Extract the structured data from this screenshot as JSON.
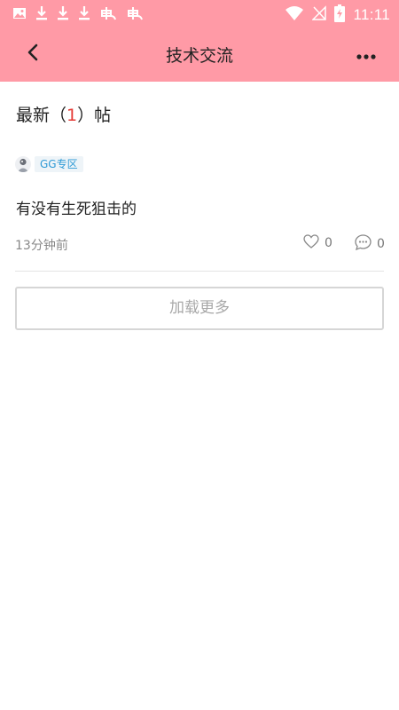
{
  "status_bar": {
    "time": "11:11",
    "icons": [
      "image-icon",
      "download-icon",
      "download-icon",
      "download-icon",
      "bug-app-icon",
      "bug-app-icon",
      "wifi-icon",
      "no-signal-icon",
      "battery-charging-icon"
    ]
  },
  "header": {
    "title": "技术交流",
    "back_icon": "chevron-left-icon",
    "more_icon": "more-dots-icon"
  },
  "section": {
    "prefix": "最新（",
    "count": "1",
    "suffix": "）帖"
  },
  "posts": [
    {
      "tag": "GG专区",
      "title": "有没有生死狙击的",
      "time": "13分钟前",
      "likes": "0",
      "comments": "0"
    }
  ],
  "load_more_label": "加载更多",
  "colors": {
    "header_bg": "#ff9aa6",
    "tag_text": "#2f9ad6",
    "count_red": "#e53935"
  }
}
